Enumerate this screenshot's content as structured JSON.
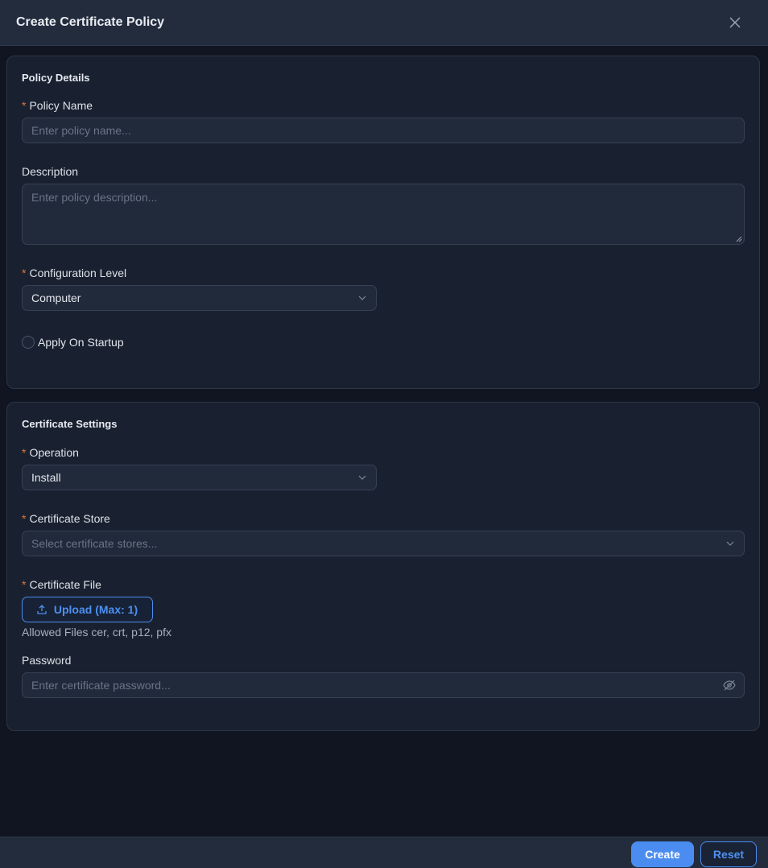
{
  "dialog": {
    "title": "Create Certificate Policy",
    "close_icon": "close-icon"
  },
  "policy_details": {
    "section_title": "Policy Details",
    "policy_name": {
      "label": "Policy Name",
      "required_mark": "*",
      "placeholder": "Enter policy name...",
      "value": ""
    },
    "description": {
      "label": "Description",
      "placeholder": "Enter policy description...",
      "value": ""
    },
    "configuration_level": {
      "label": "Configuration Level",
      "required_mark": "*",
      "selected": "Computer"
    },
    "apply_on_startup": {
      "label": "Apply On Startup",
      "checked": false
    }
  },
  "certificate_settings": {
    "section_title": "Certificate Settings",
    "operation": {
      "label": "Operation",
      "required_mark": "*",
      "selected": "Install"
    },
    "certificate_store": {
      "label": "Certificate Store",
      "required_mark": "*",
      "placeholder": "Select certificate stores..."
    },
    "certificate_file": {
      "label": "Certificate File",
      "required_mark": "*",
      "upload_label": "Upload (Max: 1)",
      "allowed_hint": "Allowed Files cer, crt, p12, pfx"
    },
    "password": {
      "label": "Password",
      "placeholder": "Enter certificate password...",
      "value": ""
    }
  },
  "footer": {
    "create_label": "Create",
    "reset_label": "Reset"
  },
  "colors": {
    "accent": "#4a8cf0",
    "required": "#e2743c",
    "background": "#101521",
    "card": "#192130"
  }
}
